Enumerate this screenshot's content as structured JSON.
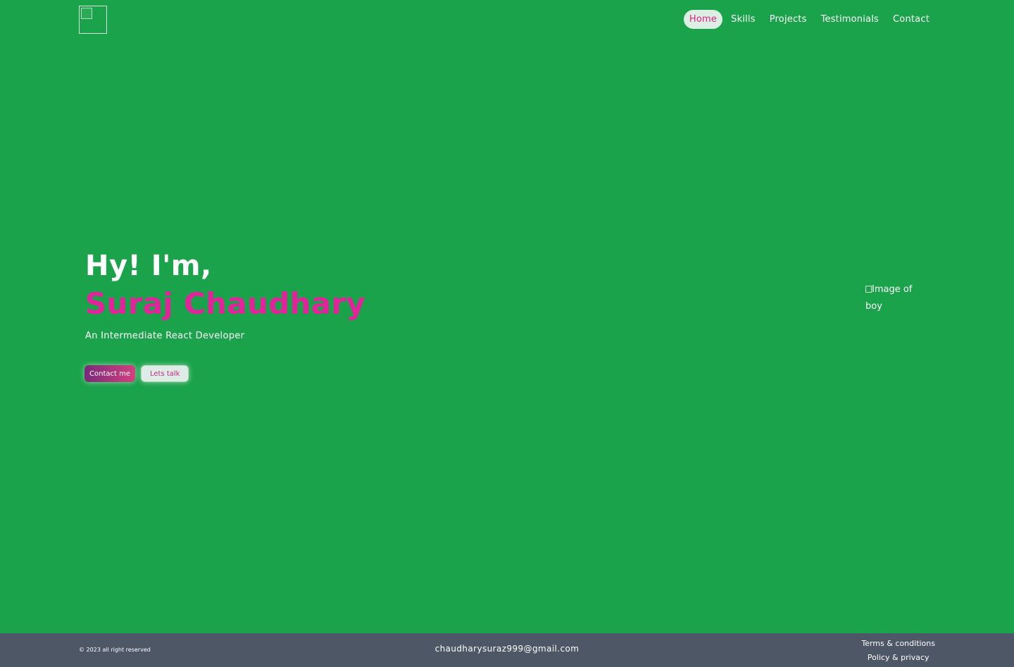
{
  "header": {
    "logo_alt": "",
    "nav": [
      {
        "label": "Home",
        "active": true
      },
      {
        "label": "Skills",
        "active": false
      },
      {
        "label": "Projects",
        "active": false
      },
      {
        "label": "Testimonials",
        "active": false
      },
      {
        "label": "Contact",
        "active": false
      }
    ]
  },
  "hero": {
    "greeting": "Hy! I'm,",
    "name": "Suraj Chaudhary",
    "tagline": "An Intermediate React Developer",
    "contact_button": "Contact me",
    "talk_button": "Lets talk",
    "image_alt": "Image of boy"
  },
  "footer": {
    "copyright": "© 2023 all right reserved",
    "email": "chaudharysuraz999@gmail.com",
    "links": [
      "Terms & conditions",
      "Policy & privacy"
    ]
  },
  "colors": {
    "background": "#1aa34a",
    "accent": "#e3239b",
    "footer_bg": "#4d5766"
  }
}
